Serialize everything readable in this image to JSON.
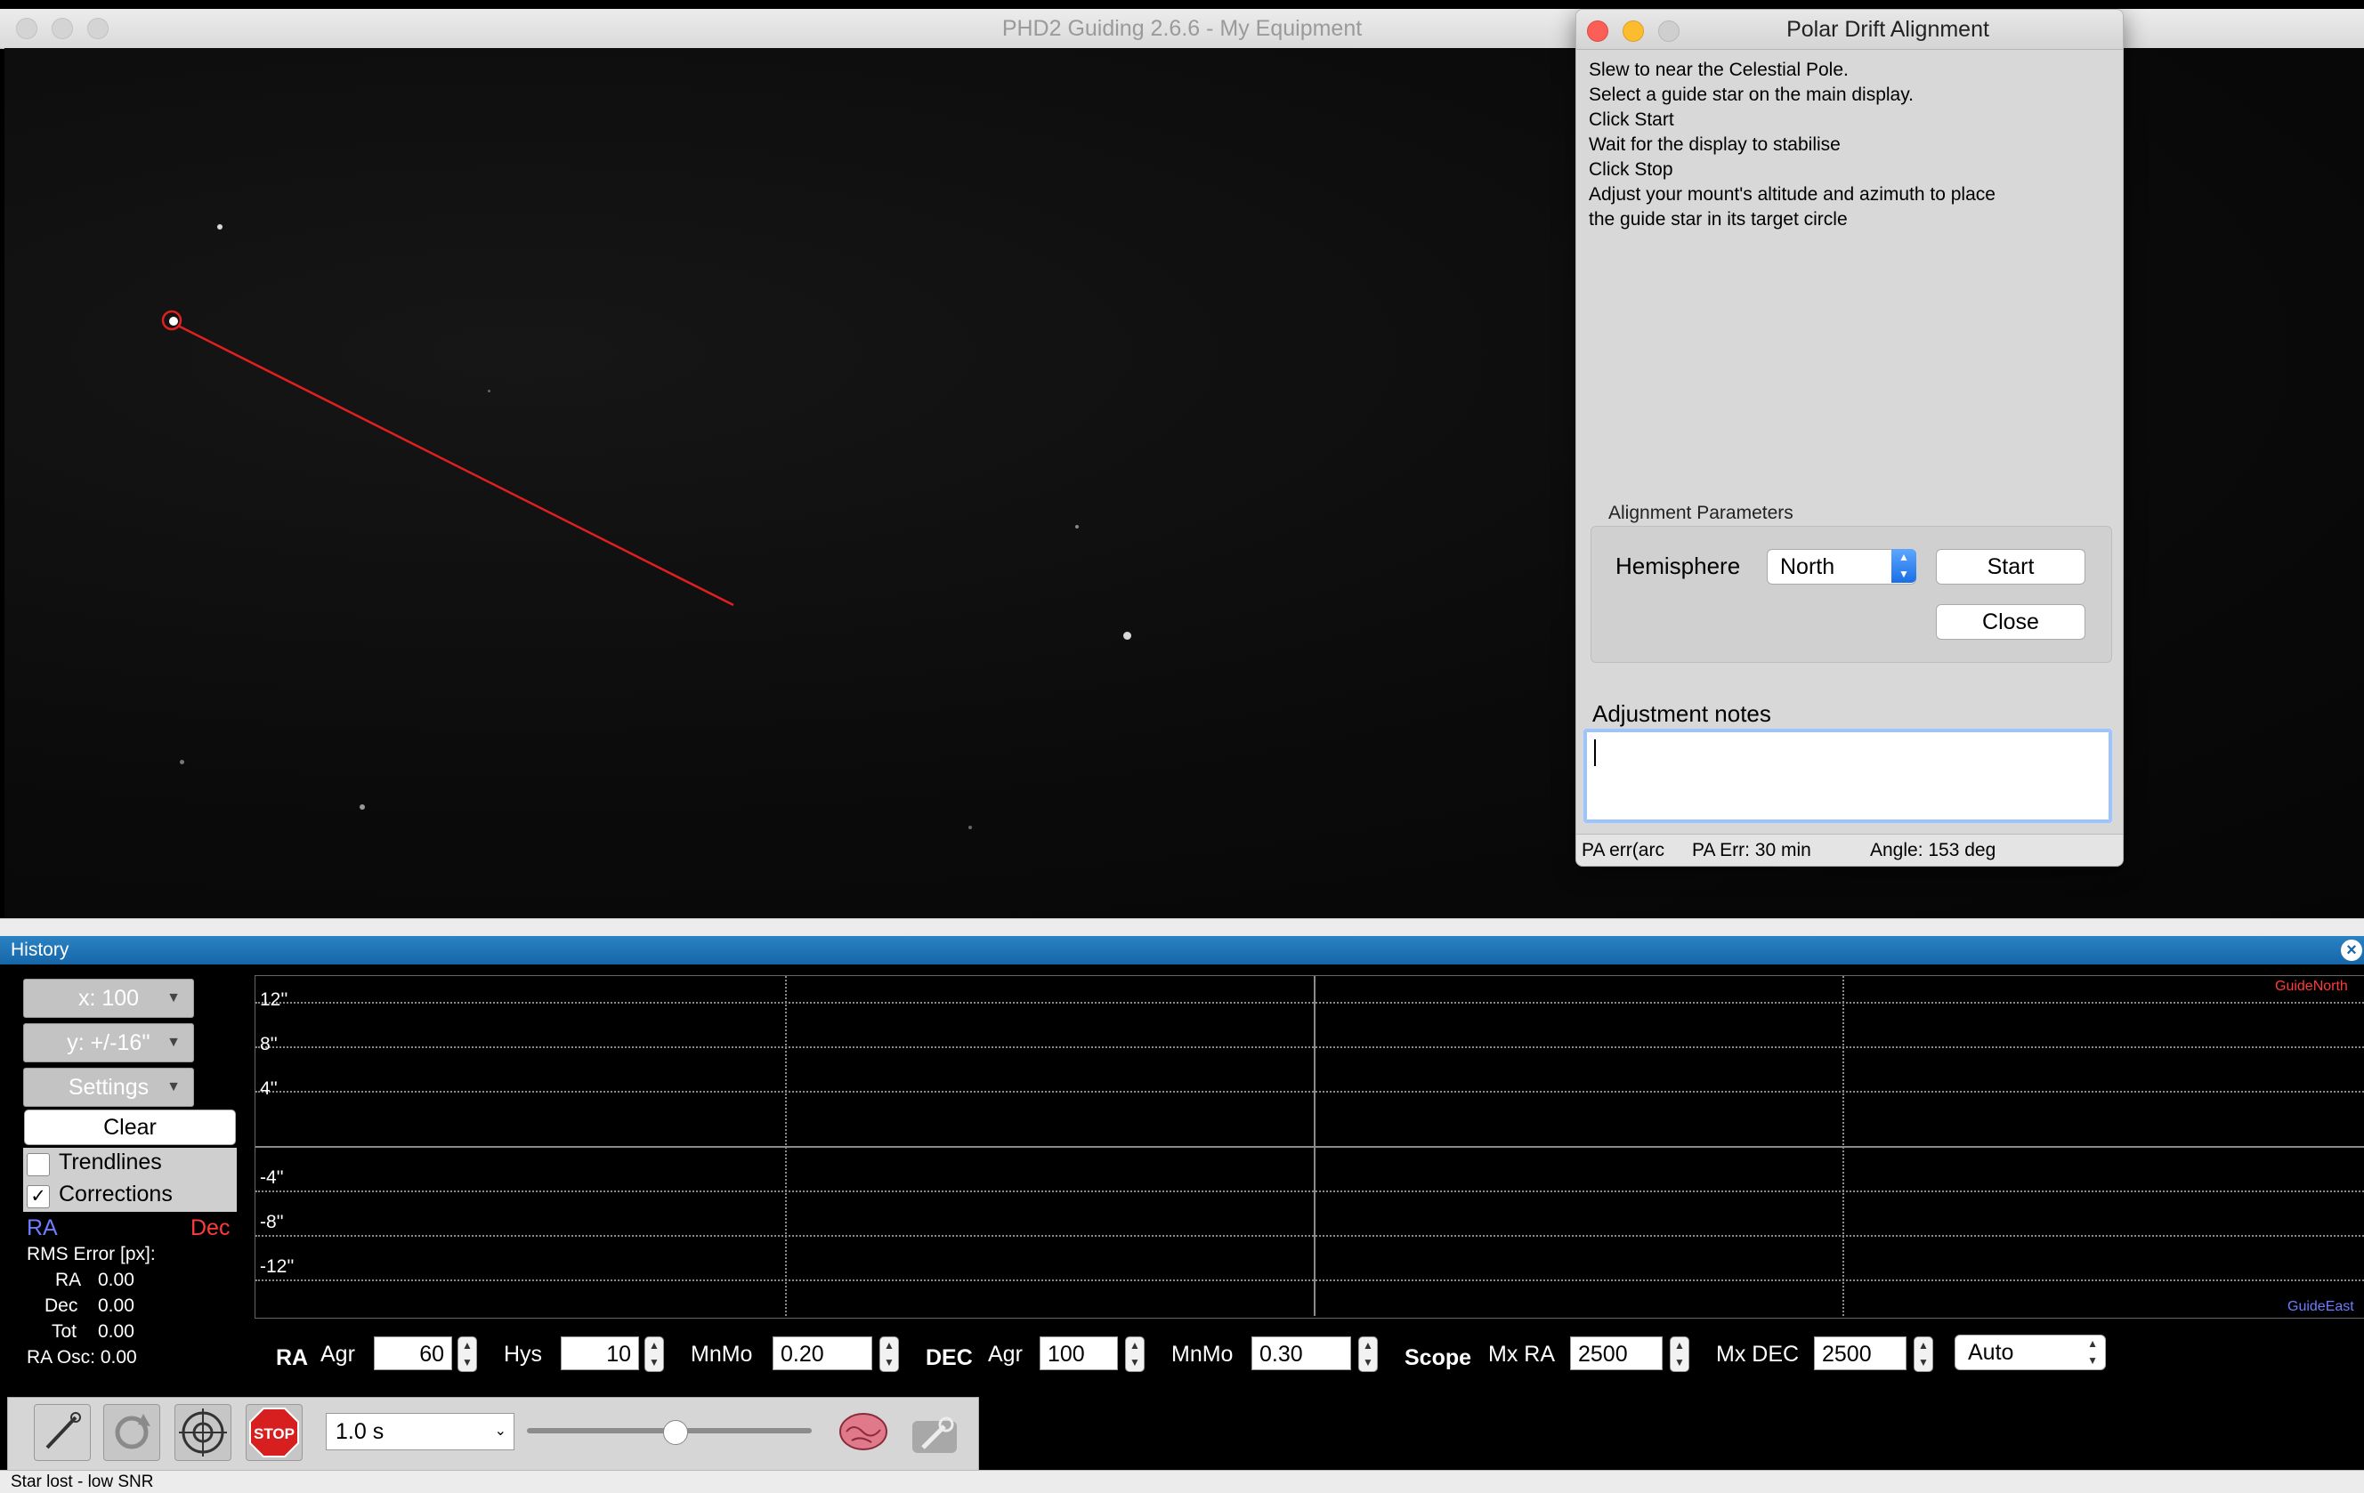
{
  "window": {
    "title": "PHD2 Guiding 2.6.6 - My Equipment"
  },
  "history": {
    "title": "History",
    "x_scale": "x: 100",
    "y_scale": "y: +/-16''",
    "settings": "Settings",
    "clear": "Clear",
    "trendlines": "Trendlines",
    "corrections": "Corrections",
    "corrections_check": "✓",
    "ra_legend": "RA",
    "dec_legend": "Dec",
    "rms_label": "RMS Error [px]:",
    "ra_label": "RA",
    "ra_value": "0.00",
    "dec_label": "Dec",
    "dec_value": "0.00",
    "tot_label": "Tot",
    "tot_value": "0.00",
    "osc": "RA Osc: 0.00",
    "y_labels": [
      "12''",
      "8''",
      "4''",
      "-4''",
      "-8''",
      "-12''"
    ],
    "guide_north": "GuideNorth",
    "guide_east": "GuideEast"
  },
  "guide_params": {
    "ra": "RA",
    "ra_agr_label": "Agr",
    "ra_agr": "60",
    "ra_hys_label": "Hys",
    "ra_hys": "10",
    "ra_mnmo_label": "MnMo",
    "ra_mnmo": "0.20",
    "dec": "DEC",
    "dec_agr_label": "Agr",
    "dec_agr": "100",
    "dec_mnmo_label": "MnMo",
    "dec_mnmo": "0.30",
    "scope": "Scope",
    "mxra_label": "Mx RA",
    "mxra": "2500",
    "mxdec_label": "Mx DEC",
    "mxdec": "2500",
    "mode": "Auto"
  },
  "toolbar": {
    "exposure": "1.0 s",
    "exposure_slider_fraction": 0.52,
    "stop_label": "STOP"
  },
  "statusbar": {
    "text": "Star lost - low SNR"
  },
  "dialog": {
    "title": "Polar Drift Alignment",
    "instructions": [
      "Slew to near the Celestial Pole.",
      "Select a guide star on the main display.",
      "Click Start",
      "Wait for the display to stabilise",
      "Click Stop",
      "Adjust your mount's altitude and azimuth to place",
      "the guide star in its target circle"
    ],
    "params_title": "Alignment Parameters",
    "hemisphere_label": "Hemisphere",
    "hemisphere_value": "North",
    "start": "Start",
    "close": "Close",
    "notes_label": "Adjustment notes",
    "notes_value": "",
    "status_1": "PA err(arc",
    "status_2": "PA Err: 30 min",
    "status_3": "Angle: 153 deg"
  },
  "colors": {
    "ra": "#6e7cff",
    "dec": "#ff3b3b",
    "accent": "#1a6fe6",
    "alignment_line": "#e02020"
  }
}
